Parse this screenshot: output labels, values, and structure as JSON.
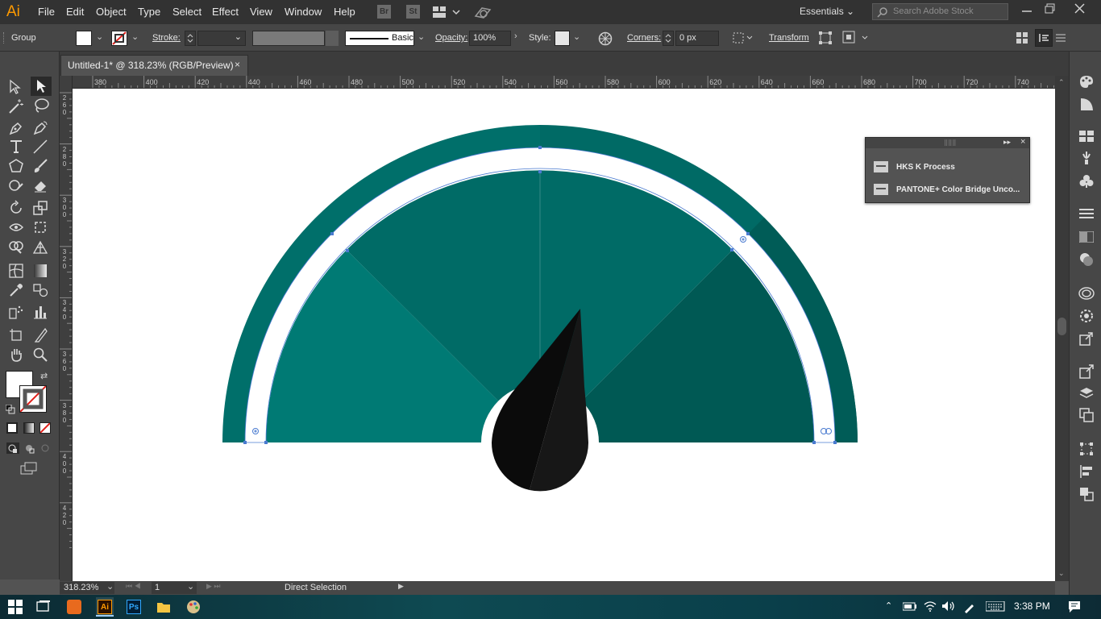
{
  "app": {
    "logo": "Ai",
    "accent": "#ff9a00"
  },
  "menus": [
    "File",
    "Edit",
    "Object",
    "Type",
    "Select",
    "Effect",
    "View",
    "Window",
    "Help"
  ],
  "bridge_badges": [
    "Br",
    "St"
  ],
  "workspace": {
    "label": "Essentials",
    "search_placeholder": "Search Adobe Stock"
  },
  "control": {
    "selection": "Group",
    "stroke_label": "Stroke:",
    "brush_label": "Basic",
    "opacity_label": "Opacity:",
    "opacity_value": "100%",
    "style_label": "Style:",
    "corners_label": "Corners:",
    "corners_value": "0 px",
    "transform_label": "Transform"
  },
  "document": {
    "tab_title": "Untitled-1* @ 318.23% (RGB/Preview)",
    "close": "×"
  },
  "ruler": {
    "h_labels": [
      "380",
      "400",
      "420",
      "440",
      "460",
      "480",
      "500",
      "520",
      "540",
      "560",
      "580",
      "600",
      "620",
      "640",
      "660",
      "680",
      "700",
      "720",
      "740"
    ],
    "v_labels": [
      [
        "2",
        "6",
        "0"
      ],
      [
        "2",
        "8",
        "0"
      ],
      [
        "3",
        "0",
        "0"
      ],
      [
        "3",
        "2",
        "0"
      ],
      [
        "3",
        "4",
        "0"
      ],
      [
        "3",
        "6",
        "0"
      ],
      [
        "3",
        "8",
        "0"
      ],
      [
        "4",
        "0",
        "0"
      ],
      [
        "4",
        "2",
        "0"
      ]
    ]
  },
  "swatch_panel": {
    "items": [
      "HKS K Process",
      "PANTONE+ Color Bridge Unco..."
    ]
  },
  "status": {
    "zoom": "318.23%",
    "artboard": "1",
    "tool": "Direct Selection"
  },
  "artwork": {
    "outer_ring": "#006f6a",
    "ring_dark": "#005c57",
    "gap": "#ffffff",
    "seg_left": "#007a74",
    "seg_mid": "#006b66",
    "seg_right": "#005954",
    "needle": "#0d0d0d",
    "selection": "#4a7bd0"
  },
  "taskbar": {
    "time": "3:38 PM"
  }
}
